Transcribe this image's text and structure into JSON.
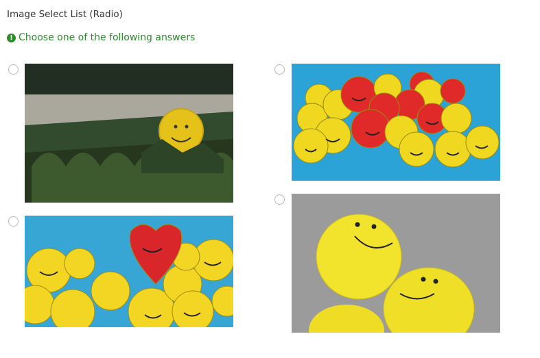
{
  "question": {
    "title": "Image Select List (Radio)",
    "help_text": "Choose one of the following answers",
    "help_icon": "exclamation-circle-icon",
    "help_color": "#2e8b2e"
  },
  "options": [
    {
      "image": "smiley-ball-in-grass",
      "selected": false
    },
    {
      "image": "pile-of-yellow-and-red-smiley-balls",
      "selected": false
    },
    {
      "image": "red-heart-smiley-among-yellow-balls",
      "selected": false
    },
    {
      "image": "yellow-smiley-balloons",
      "selected": false
    }
  ]
}
